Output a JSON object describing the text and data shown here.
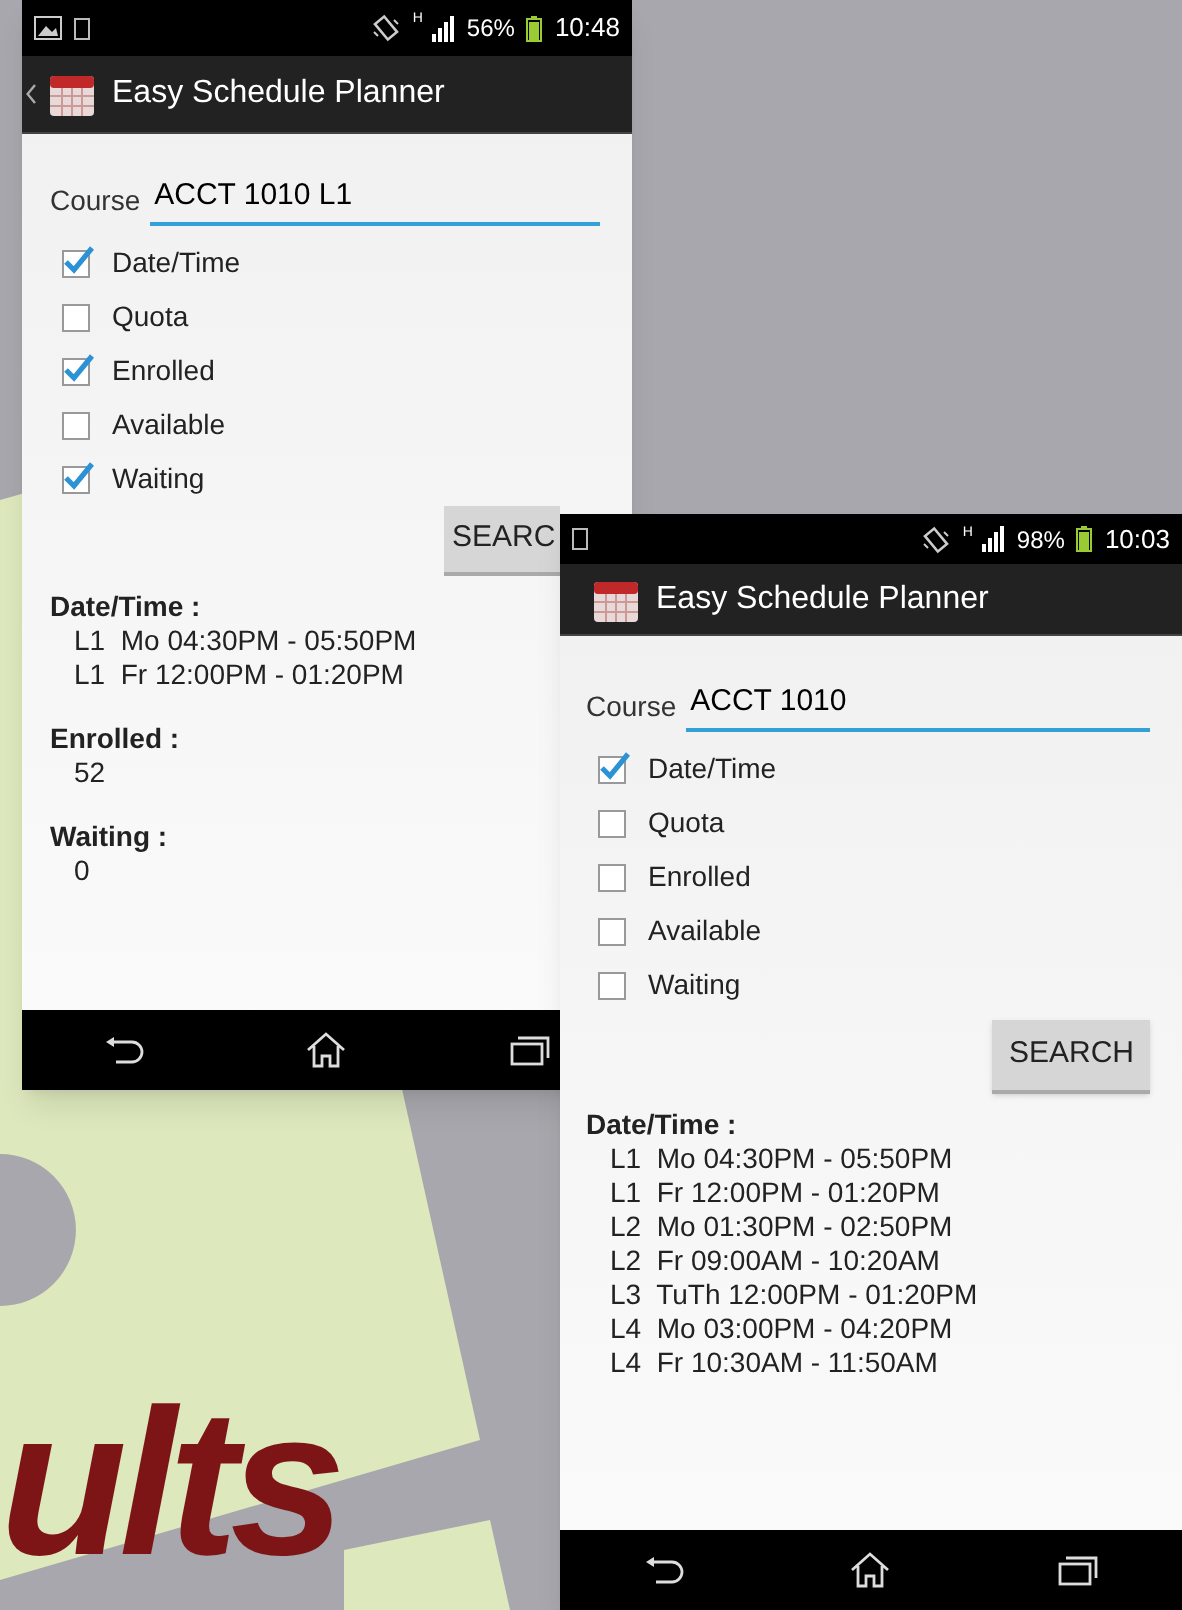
{
  "background": {
    "text": "ults"
  },
  "phones": [
    {
      "status": {
        "photo_notification": true,
        "network": "H",
        "battery": "56%",
        "time": "10:48"
      },
      "app_bar": {
        "back_arrow": true,
        "title": "Easy Schedule Planner"
      },
      "course": {
        "label": "Course",
        "value": "ACCT 1010 L1"
      },
      "options": [
        {
          "label": "Date/Time",
          "checked": true
        },
        {
          "label": "Quota",
          "checked": false
        },
        {
          "label": "Enrolled",
          "checked": true
        },
        {
          "label": "Available",
          "checked": false
        },
        {
          "label": "Waiting",
          "checked": true
        }
      ],
      "search_button": "SEARC",
      "results": [
        {
          "heading": "Date/Time :",
          "lines": [
            "L1  Mo 04:30PM - 05:50PM",
            "L1  Fr 12:00PM - 01:20PM"
          ]
        },
        {
          "heading": "Enrolled :",
          "lines": [
            "52"
          ]
        },
        {
          "heading": "Waiting :",
          "lines": [
            "0"
          ]
        }
      ]
    },
    {
      "status": {
        "photo_notification": false,
        "network": "H",
        "battery": "98%",
        "time": "10:03"
      },
      "app_bar": {
        "back_arrow": false,
        "title": "Easy Schedule Planner"
      },
      "course": {
        "label": "Course",
        "value": "ACCT 1010"
      },
      "options": [
        {
          "label": "Date/Time",
          "checked": true
        },
        {
          "label": "Quota",
          "checked": false
        },
        {
          "label": "Enrolled",
          "checked": false
        },
        {
          "label": "Available",
          "checked": false
        },
        {
          "label": "Waiting",
          "checked": false
        }
      ],
      "search_button": "SEARCH",
      "results": [
        {
          "heading": "Date/Time :",
          "lines": [
            "L1  Mo 04:30PM - 05:50PM",
            "L1  Fr 12:00PM - 01:20PM",
            "L2  Mo 01:30PM - 02:50PM",
            "L2  Fr 09:00AM - 10:20AM",
            "L3  TuTh 12:00PM - 01:20PM",
            "L4  Mo 03:00PM - 04:20PM",
            "L4  Fr 10:30AM - 11:50AM"
          ]
        }
      ]
    }
  ]
}
